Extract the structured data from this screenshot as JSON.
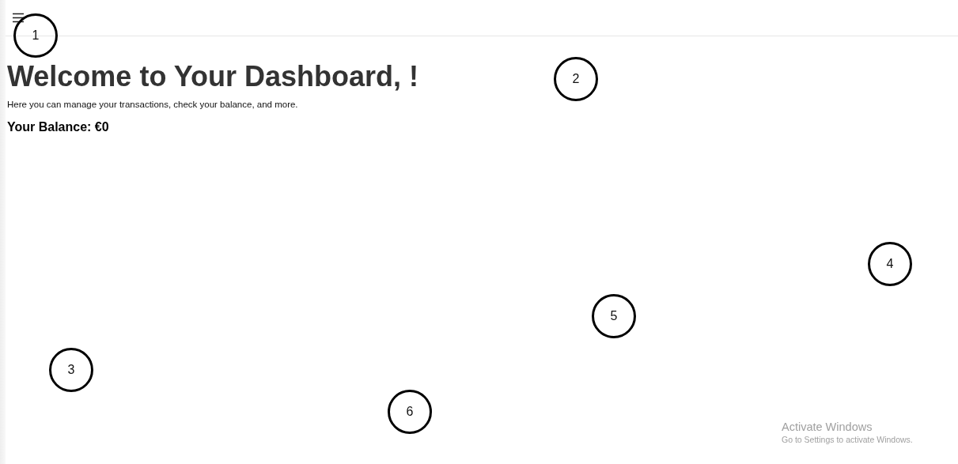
{
  "main": {
    "title": "Welcome to Your Dashboard, !",
    "intro": "Here you can manage your transactions, check your balance, and more.",
    "balance": "Your Balance: €0"
  },
  "callouts": [
    "1",
    "2",
    "3",
    "4",
    "5",
    "6"
  ],
  "os_notice": {
    "title": "Activate Windows",
    "subtitle": "Go to Settings to activate Windows."
  }
}
